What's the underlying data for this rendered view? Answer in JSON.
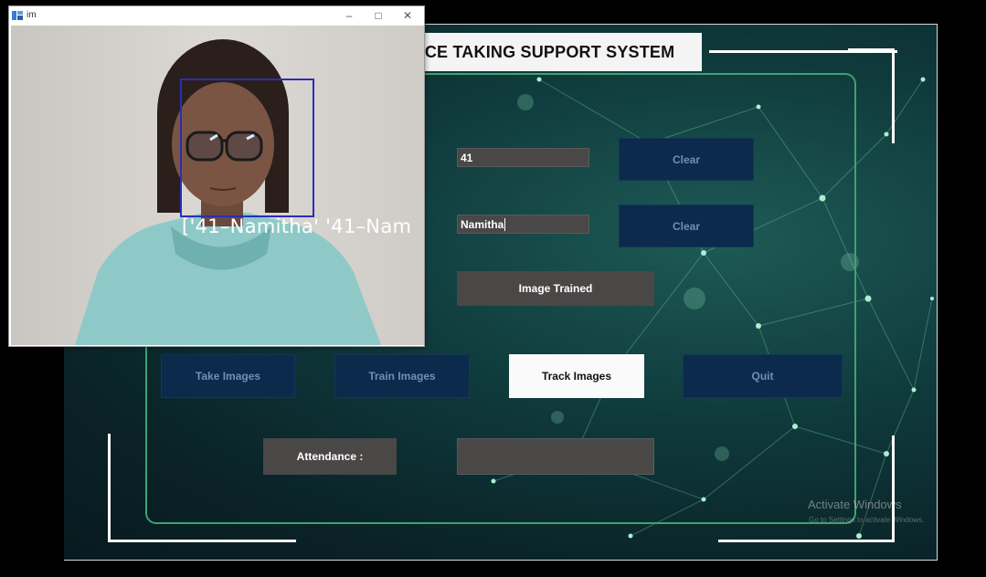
{
  "app": {
    "title": "ICE TAKING SUPPORT SYSTEM",
    "id_field_value": "41",
    "name_field_value": "Namitha",
    "clear_id_label": "Clear",
    "clear_name_label": "Clear",
    "status_message": "Image Trained",
    "take_images_label": "Take Images",
    "train_images_label": "Train Images",
    "track_images_label": "Track Images",
    "quit_label": "Quit",
    "attendance_label": "Attendance :",
    "attendance_value": ""
  },
  "camera_window": {
    "title": "im",
    "recognized_label": "['41–Namitha' '41–Nam"
  },
  "os_watermark": {
    "title": "Activate Windows",
    "subtitle": "Go to Settings to activate Windows."
  },
  "colors": {
    "frame_green": "#3fa273",
    "navy_button": "#0b2a4c",
    "field_gray": "#4a4747",
    "face_box": "#2c2cb8"
  }
}
